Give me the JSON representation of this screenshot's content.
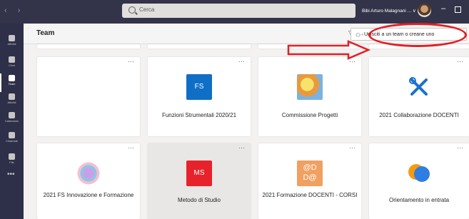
{
  "titlebar": {
    "search_placeholder": "Cerca",
    "user_name": "Bibi Arturo Malagnani ... ∨"
  },
  "rail": {
    "items": [
      {
        "label": "Attività"
      },
      {
        "label": "Chat"
      },
      {
        "label": "Team"
      },
      {
        "label": "Attività"
      },
      {
        "label": "Calendario"
      },
      {
        "label": "Chiamate"
      },
      {
        "label": "File"
      }
    ]
  },
  "header": {
    "title": "Team",
    "join_button_label": "Unisciti a un team o creane uno"
  },
  "teams": [
    {
      "name": "",
      "initials": "",
      "color": "#ffffff"
    },
    {
      "name": "Funzioni Strumentali 2020/21",
      "initials": "FS",
      "color": "#0f6fc6"
    },
    {
      "name": "Commissione Progetti",
      "initials": "",
      "color": "#f0d060"
    },
    {
      "name": "2021 Collaborazione DOCENTI",
      "initials": "",
      "color": "#1a73c9"
    },
    {
      "name": "2021 FS Innovazione e Formazione",
      "initials": "",
      "color": "#d4b0e0"
    },
    {
      "name": "Metodo di Studio",
      "initials": "MS",
      "color": "#e8222a"
    },
    {
      "name": "2021 Formazione DOCENTI - CORSI",
      "initials": "@D D@",
      "color": "#f0a060"
    },
    {
      "name": "Orientamento in entrata",
      "initials": "",
      "color": "#2e7de1"
    }
  ],
  "colors": {
    "titlebar": "#33344a",
    "rail": "#2e2f49",
    "annotation": "#e31e24"
  }
}
